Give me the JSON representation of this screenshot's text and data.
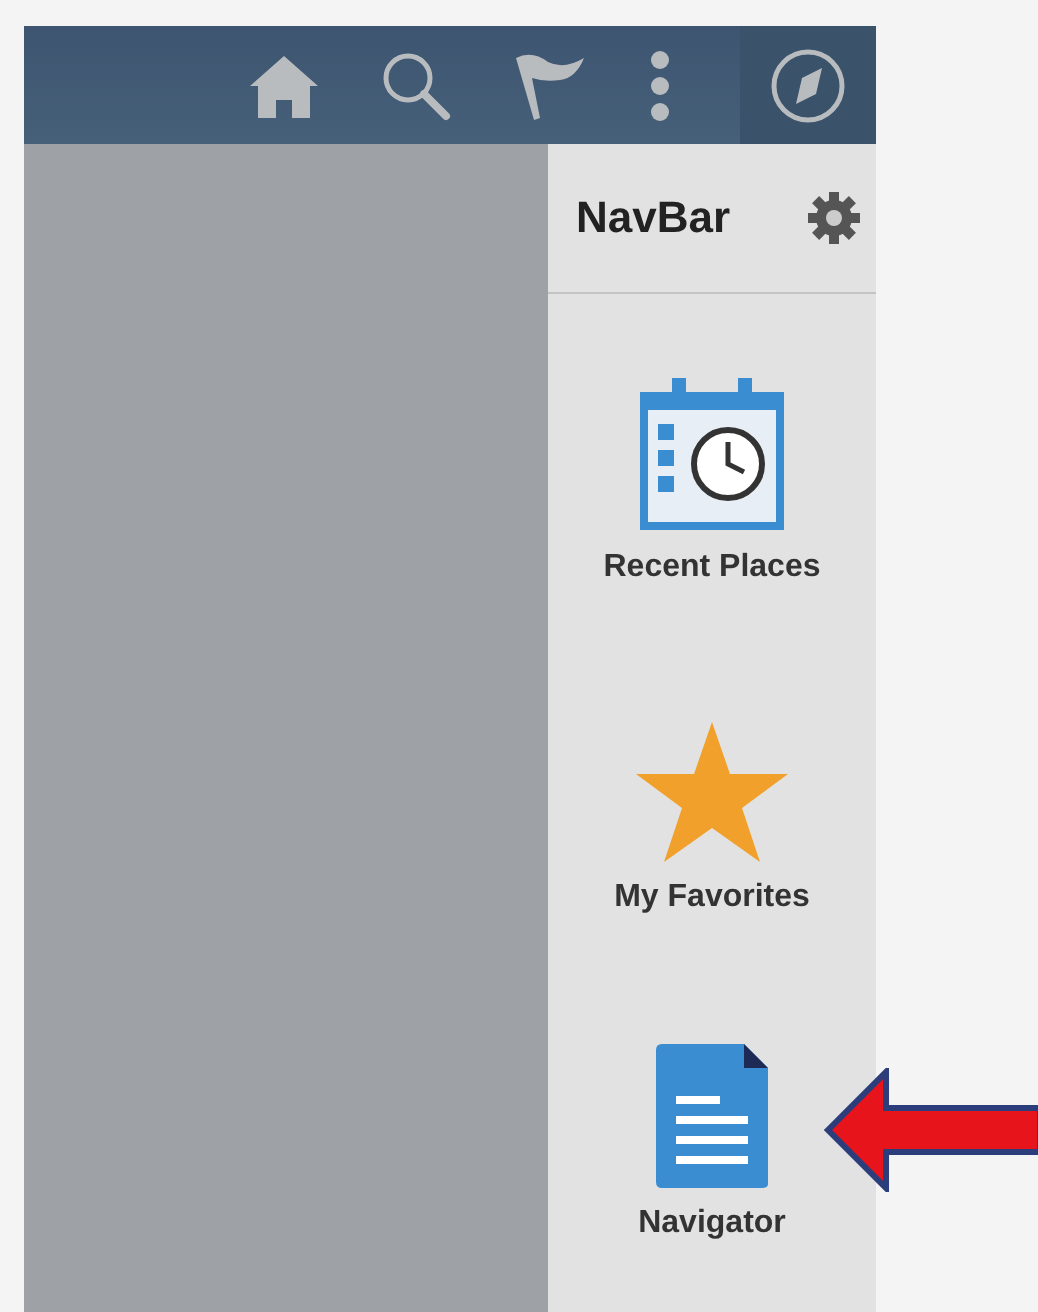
{
  "navbar": {
    "title": "NavBar",
    "items": [
      {
        "label": "Recent Places",
        "kind": "recent"
      },
      {
        "label": "My Favorites",
        "kind": "favorites"
      },
      {
        "label": "Navigator",
        "kind": "navigator"
      }
    ]
  }
}
